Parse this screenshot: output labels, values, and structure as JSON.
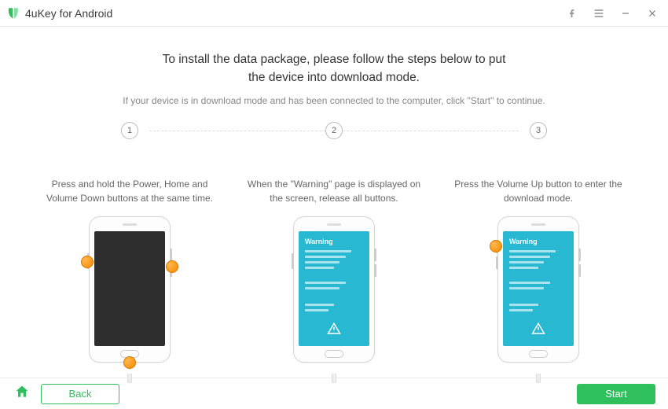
{
  "titlebar": {
    "app_name": "4uKey for Android"
  },
  "header": {
    "headline_line1": "To install the data package, please follow the steps below to put",
    "headline_line2": "the device into download mode.",
    "subhead": "If your device is in download mode and has been connected to the computer, click \"Start\" to continue."
  },
  "steps": [
    {
      "num": "1",
      "desc": "Press and hold the Power, Home and Volume Down buttons at the same time."
    },
    {
      "num": "2",
      "desc": "When the \"Warning\" page is displayed on the screen, release all buttons."
    },
    {
      "num": "3",
      "desc": "Press the Volume Up button to enter the download mode."
    }
  ],
  "phone": {
    "warning_title": "Warning"
  },
  "footer": {
    "back_label": "Back",
    "start_label": "Start"
  },
  "colors": {
    "brand": "#2fbf5c",
    "phone_warning_bg": "#29b8d1",
    "highlight_dot": "#f58a00"
  }
}
